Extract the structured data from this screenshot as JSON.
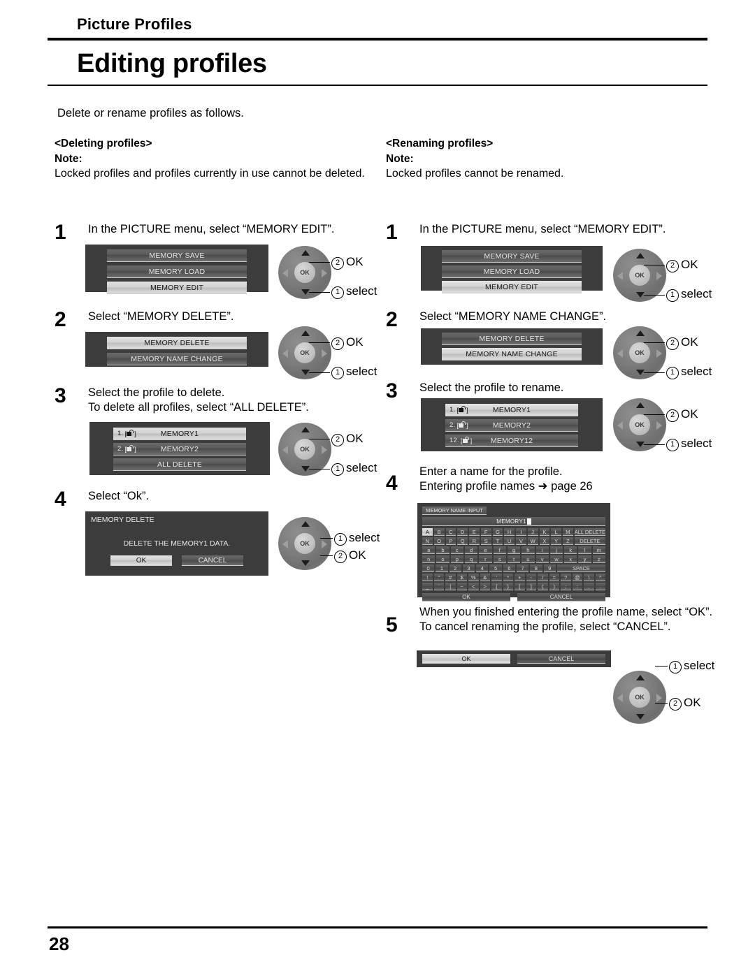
{
  "header": {
    "chapter": "Picture Profiles",
    "title": "Editing profiles",
    "intro": "Delete or rename profiles as follows."
  },
  "footer": {
    "page_number": "28"
  },
  "callout": {
    "select_num": "1",
    "select_label": "select",
    "ok_num": "2",
    "ok_label": "OK",
    "dpad_center_label": "OK"
  },
  "left": {
    "section_heading": "<Deleting profiles>",
    "note_label": "Note:",
    "note_body": "Locked profiles and profiles currently in use cannot be deleted.",
    "steps": [
      {
        "number": "1",
        "lines": [
          "In the PICTURE menu, select “MEMORY EDIT”."
        ]
      },
      {
        "number": "2",
        "lines": [
          "Select “MEMORY DELETE”."
        ]
      },
      {
        "number": "3",
        "lines": [
          "Select the profile to delete.",
          "To delete all profiles, select “ALL DELETE”."
        ]
      },
      {
        "number": "4",
        "lines": [
          "Select “Ok”."
        ]
      }
    ],
    "menu_edit": {
      "items": [
        {
          "label": "MEMORY SAVE",
          "selected": false
        },
        {
          "label": "MEMORY LOAD",
          "selected": false
        },
        {
          "label": "MEMORY EDIT",
          "selected": true
        }
      ]
    },
    "menu_delete": {
      "items": [
        {
          "label": "MEMORY DELETE",
          "selected": true
        },
        {
          "label": "MEMORY NAME CHANGE",
          "selected": false
        }
      ]
    },
    "menu_profiles": {
      "items": [
        {
          "index": "1.",
          "lock": true,
          "label": "MEMORY1",
          "selected": true
        },
        {
          "index": "2.",
          "lock": true,
          "label": "MEMORY2",
          "selected": false
        },
        {
          "index": "",
          "lock": false,
          "label": "ALL DELETE",
          "selected": false
        }
      ]
    },
    "dialog": {
      "title": "MEMORY DELETE",
      "message": "DELETE THE MEMORY1 DATA.",
      "ok_label": "OK",
      "cancel_label": "CANCEL"
    }
  },
  "right": {
    "section_heading": "<Renaming profiles>",
    "note_label": "Note:",
    "note_body": "Locked profiles cannot be renamed.",
    "steps": [
      {
        "number": "1",
        "lines": [
          "In the PICTURE menu, select “MEMORY EDIT”."
        ]
      },
      {
        "number": "2",
        "lines": [
          "Select “MEMORY NAME CHANGE”."
        ]
      },
      {
        "number": "3",
        "lines": [
          "Select the profile to rename."
        ]
      },
      {
        "number": "4",
        "lines": [
          "Enter a name for the profile.",
          "Entering profile names ➜ page 26"
        ]
      },
      {
        "number": "5",
        "lines": [
          "When you finished entering the profile name, select “OK”.",
          "To cancel renaming the profile, select “CANCEL”."
        ]
      }
    ],
    "menu_edit": {
      "items": [
        {
          "label": "MEMORY SAVE",
          "selected": false
        },
        {
          "label": "MEMORY LOAD",
          "selected": false
        },
        {
          "label": "MEMORY EDIT",
          "selected": true
        }
      ]
    },
    "menu_namechange": {
      "items": [
        {
          "label": "MEMORY DELETE",
          "selected": false
        },
        {
          "label": "MEMORY NAME CHANGE",
          "selected": true
        }
      ]
    },
    "menu_profiles": {
      "items": [
        {
          "index": "1.",
          "lock": true,
          "label": "MEMORY1",
          "selected": true
        },
        {
          "index": "2.",
          "lock": true,
          "label": "MEMORY2",
          "selected": false
        },
        {
          "index": "12.",
          "lock": true,
          "label": "MEMORY12",
          "selected": false
        }
      ]
    },
    "keyboard": {
      "title": "MEMORY NAME INPUT",
      "field_value": "MEMORY1",
      "rows": [
        {
          "keys": [
            "A",
            "B",
            "C",
            "D",
            "E",
            "F",
            "G",
            "H",
            "I",
            "J",
            "K",
            "L",
            "M"
          ],
          "selected_index": 0,
          "tail": {
            "label": "ALL DELETE",
            "width": "wide3"
          }
        },
        {
          "keys": [
            "N",
            "O",
            "P",
            "Q",
            "R",
            "S",
            "T",
            "U",
            "V",
            "W",
            "X",
            "Y",
            "Z"
          ],
          "selected_index": -1,
          "tail": {
            "label": "DELETE",
            "width": "wide3"
          }
        },
        {
          "keys": [
            "a",
            "b",
            "c",
            "d",
            "e",
            "f",
            "g",
            "h",
            "i",
            "j",
            "k",
            "l",
            "m"
          ],
          "selected_index": -1,
          "tail": null
        },
        {
          "keys": [
            "n",
            "o",
            "p",
            "q",
            "r",
            "s",
            "t",
            "u",
            "v",
            "w",
            "x",
            "y",
            "z"
          ],
          "selected_index": -1,
          "tail": null
        },
        {
          "keys": [
            "0",
            "1",
            "2",
            "3",
            "4",
            "5",
            "6",
            "7",
            "8",
            "9"
          ],
          "selected_index": -1,
          "tail": {
            "label": "SPACE",
            "width": "wide4"
          }
        },
        {
          "keys": [
            "!",
            "\"",
            "#",
            "$",
            "%",
            "&",
            "'",
            "*",
            "+",
            "-",
            "/",
            "=",
            "?",
            "@",
            "\\",
            "^"
          ],
          "selected_index": -1,
          "tail": null
        },
        {
          "keys": [
            "_",
            "`",
            "|",
            "~",
            "<",
            ">",
            "{",
            "}",
            "[",
            "]",
            "(",
            ")",
            ";",
            ":",
            ",",
            "."
          ],
          "selected_index": -1,
          "tail": null
        }
      ],
      "ok_label": "OK",
      "cancel_label": "CANCEL"
    },
    "final_bar": {
      "ok_label": "OK",
      "cancel_label": "CANCEL",
      "ok_selected": true
    }
  }
}
